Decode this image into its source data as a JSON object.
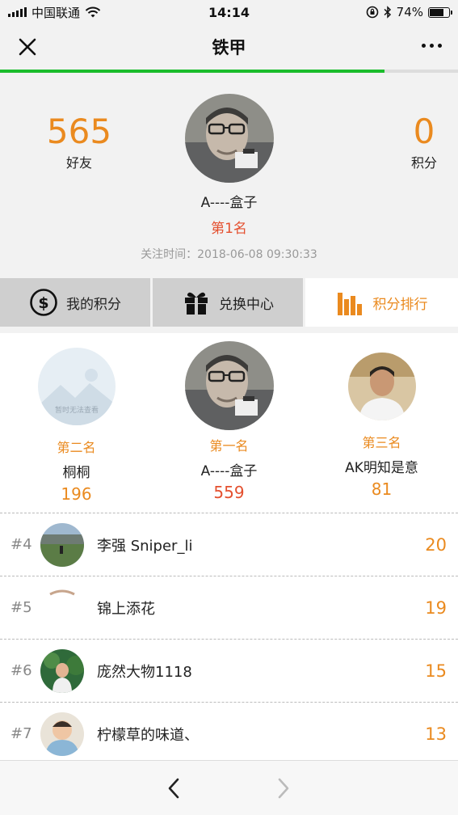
{
  "status_bar": {
    "carrier": "中国联通",
    "time": "14:14",
    "battery_percent": "74%",
    "battery_level": 0.74,
    "icons": [
      "signal-icon",
      "wifi-icon",
      "lock-rotation-icon",
      "bluetooth-icon",
      "battery-icon"
    ]
  },
  "nav": {
    "title": "铁甲",
    "close_icon": "close-icon",
    "more_icon": "more-icon",
    "load_progress": 0.84,
    "accent": "#1bbd2c"
  },
  "profile": {
    "friends_count": "565",
    "friends_label": "好友",
    "points_count": "0",
    "points_label": "积分",
    "name": "A----盒子",
    "rank": "第1名",
    "follow_time": "关注时间：2018-06-08 09:30:33"
  },
  "tabs": [
    {
      "label": "我的积分",
      "icon": "dollar-circle-icon",
      "active": false
    },
    {
      "label": "兑换中心",
      "icon": "gift-icon",
      "active": false
    },
    {
      "label": "积分排行",
      "icon": "bar-chart-icon",
      "active": true
    }
  ],
  "podium": {
    "second": {
      "rank": "第二名",
      "name": "桐桐",
      "score": "196",
      "avatar_text": "暂时无法查看"
    },
    "first": {
      "rank": "第一名",
      "name": "A----盒子",
      "score": "559"
    },
    "third": {
      "rank": "第三名",
      "name": "AK明知是意",
      "score": "81"
    }
  },
  "ranking": [
    {
      "index": "#4",
      "name": "李强 Sniper_li",
      "score": "20"
    },
    {
      "index": "#5",
      "name": "锦上添花",
      "score": "19"
    },
    {
      "index": "#6",
      "name": "庞然大物1118",
      "score": "15"
    },
    {
      "index": "#7",
      "name": "柠檬草的味道、",
      "score": "13"
    }
  ],
  "bottom_bar": {
    "back_icon": "chevron-left-icon",
    "forward_icon": "chevron-right-icon"
  },
  "colors": {
    "accent_orange": "#ea8a1f",
    "rank_red": "#e4502f",
    "progress_green": "#1bbd2c"
  }
}
